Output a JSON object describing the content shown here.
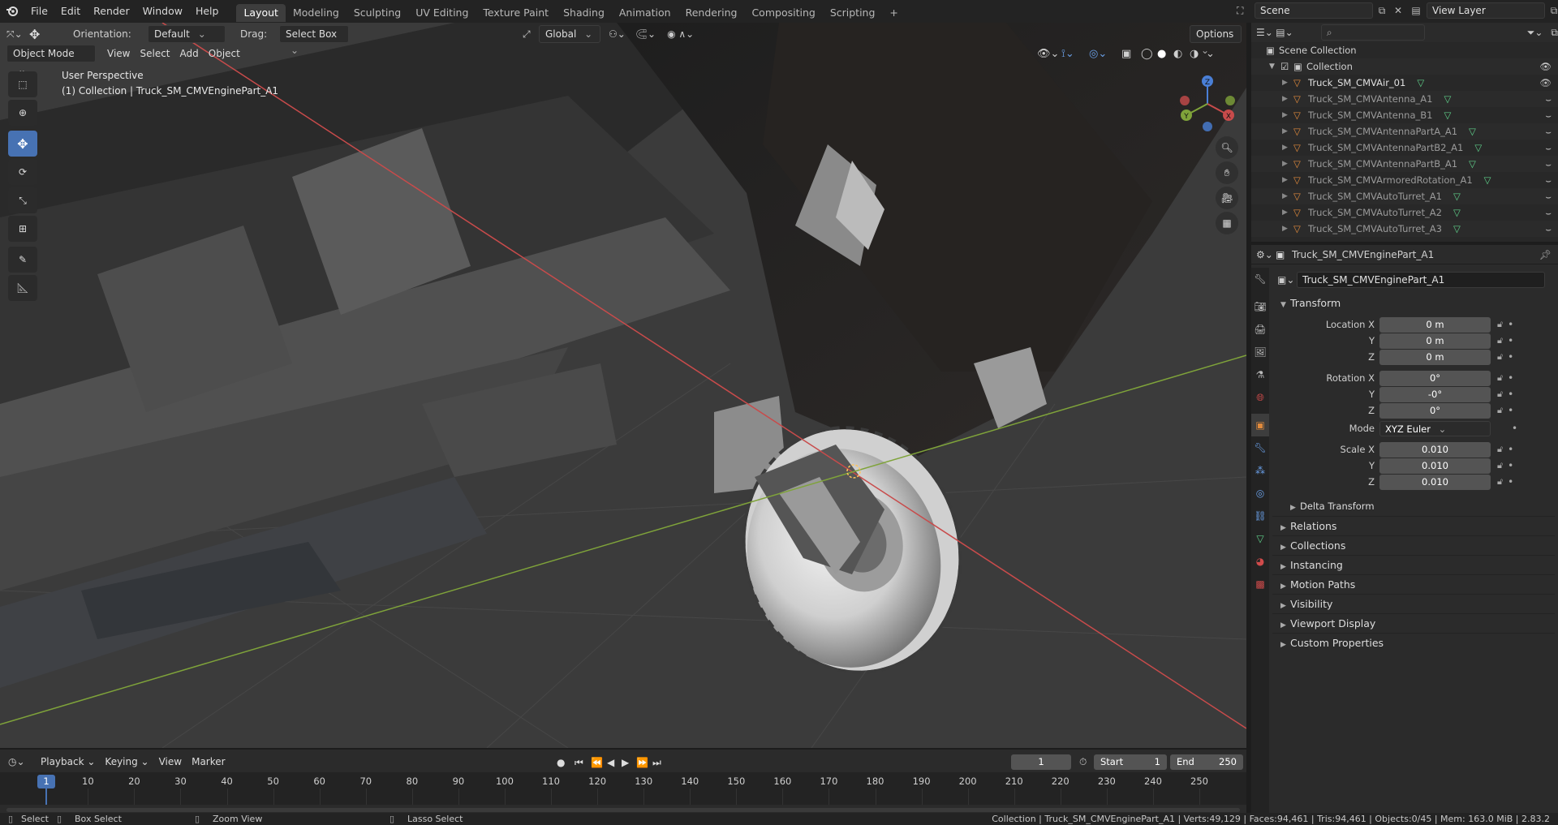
{
  "topbar": {
    "menus": [
      "File",
      "Edit",
      "Render",
      "Window",
      "Help"
    ],
    "workspaces": [
      "Layout",
      "Modeling",
      "Sculpting",
      "UV Editing",
      "Texture Paint",
      "Shading",
      "Animation",
      "Rendering",
      "Compositing",
      "Scripting"
    ],
    "active_workspace": "Layout",
    "add_workspace": "+",
    "scene": "Scene",
    "view_layer": "View Layer"
  },
  "tool_header": {
    "orientation_label": "Orientation:",
    "orientation_value": "Default",
    "drag_label": "Drag:",
    "drag_value": "Select Box",
    "transform_orientation": "Global",
    "options": "Options"
  },
  "viewport": {
    "mode": "Object Mode",
    "menus": [
      "View",
      "Select",
      "Add",
      "Object"
    ],
    "perspective": "User Perspective",
    "collection_info": "(1) Collection | Truck_SM_CMVEnginePart_A1",
    "gizmo": {
      "x": "X",
      "y": "Y",
      "z": "Z"
    }
  },
  "outliner": {
    "search_placeholder": "",
    "scene_collection": "Scene Collection",
    "collection": "Collection",
    "items": [
      "Truck_SM_CMVAir_01",
      "Truck_SM_CMVAntenna_A1",
      "Truck_SM_CMVAntenna_B1",
      "Truck_SM_CMVAntennaPartA_A1",
      "Truck_SM_CMVAntennaPartB2_A1",
      "Truck_SM_CMVAntennaPartB_A1",
      "Truck_SM_CMVArmoredRotation_A1",
      "Truck_SM_CMVAutoTurret_A1",
      "Truck_SM_CMVAutoTurret_A2",
      "Truck_SM_CMVAutoTurret_A3"
    ]
  },
  "properties": {
    "header_object": "Truck_SM_CMVEnginePart_A1",
    "object_name": "Truck_SM_CMVEnginePart_A1",
    "transform_title": "Transform",
    "location_label": "Location X",
    "rotation_label": "Rotation X",
    "scale_label": "Scale X",
    "y_label": "Y",
    "z_label": "Z",
    "location": [
      "0 m",
      "0 m",
      "0 m"
    ],
    "rotation": [
      "0°",
      "-0°",
      "0°"
    ],
    "mode_label": "Mode",
    "mode_value": "XYZ Euler",
    "scale": [
      "0.010",
      "0.010",
      "0.010"
    ],
    "delta_transform": "Delta Transform",
    "panels": [
      "Relations",
      "Collections",
      "Instancing",
      "Motion Paths",
      "Visibility",
      "Viewport Display",
      "Custom Properties"
    ]
  },
  "timeline": {
    "menus": [
      "Playback",
      "Keying",
      "View",
      "Marker"
    ],
    "current_frame": "1",
    "start_label": "Start",
    "start": "1",
    "end_label": "End",
    "end": "250",
    "ticks": [
      "1",
      "10",
      "20",
      "30",
      "40",
      "50",
      "60",
      "70",
      "80",
      "90",
      "100",
      "110",
      "120",
      "130",
      "140",
      "150",
      "160",
      "170",
      "180",
      "190",
      "200",
      "210",
      "220",
      "230",
      "240",
      "250"
    ]
  },
  "statusbar": {
    "select": "Select",
    "box_select": "Box Select",
    "zoom_view": "Zoom View",
    "lasso_select": "Lasso Select",
    "stats": "Collection | Truck_SM_CMVEnginePart_A1 | Verts:49,129 | Faces:94,461 | Tris:94,461 | Objects:0/45 | Mem: 163.0 MiB | 2.83.2"
  },
  "colors": {
    "accent": "#4772b3",
    "axis_x": "#c84b4b",
    "axis_y": "#7fa33a",
    "axis_z": "#4a7fd6",
    "mesh_icon": "#5fcf8a",
    "object_icon": "#e08a3c"
  }
}
